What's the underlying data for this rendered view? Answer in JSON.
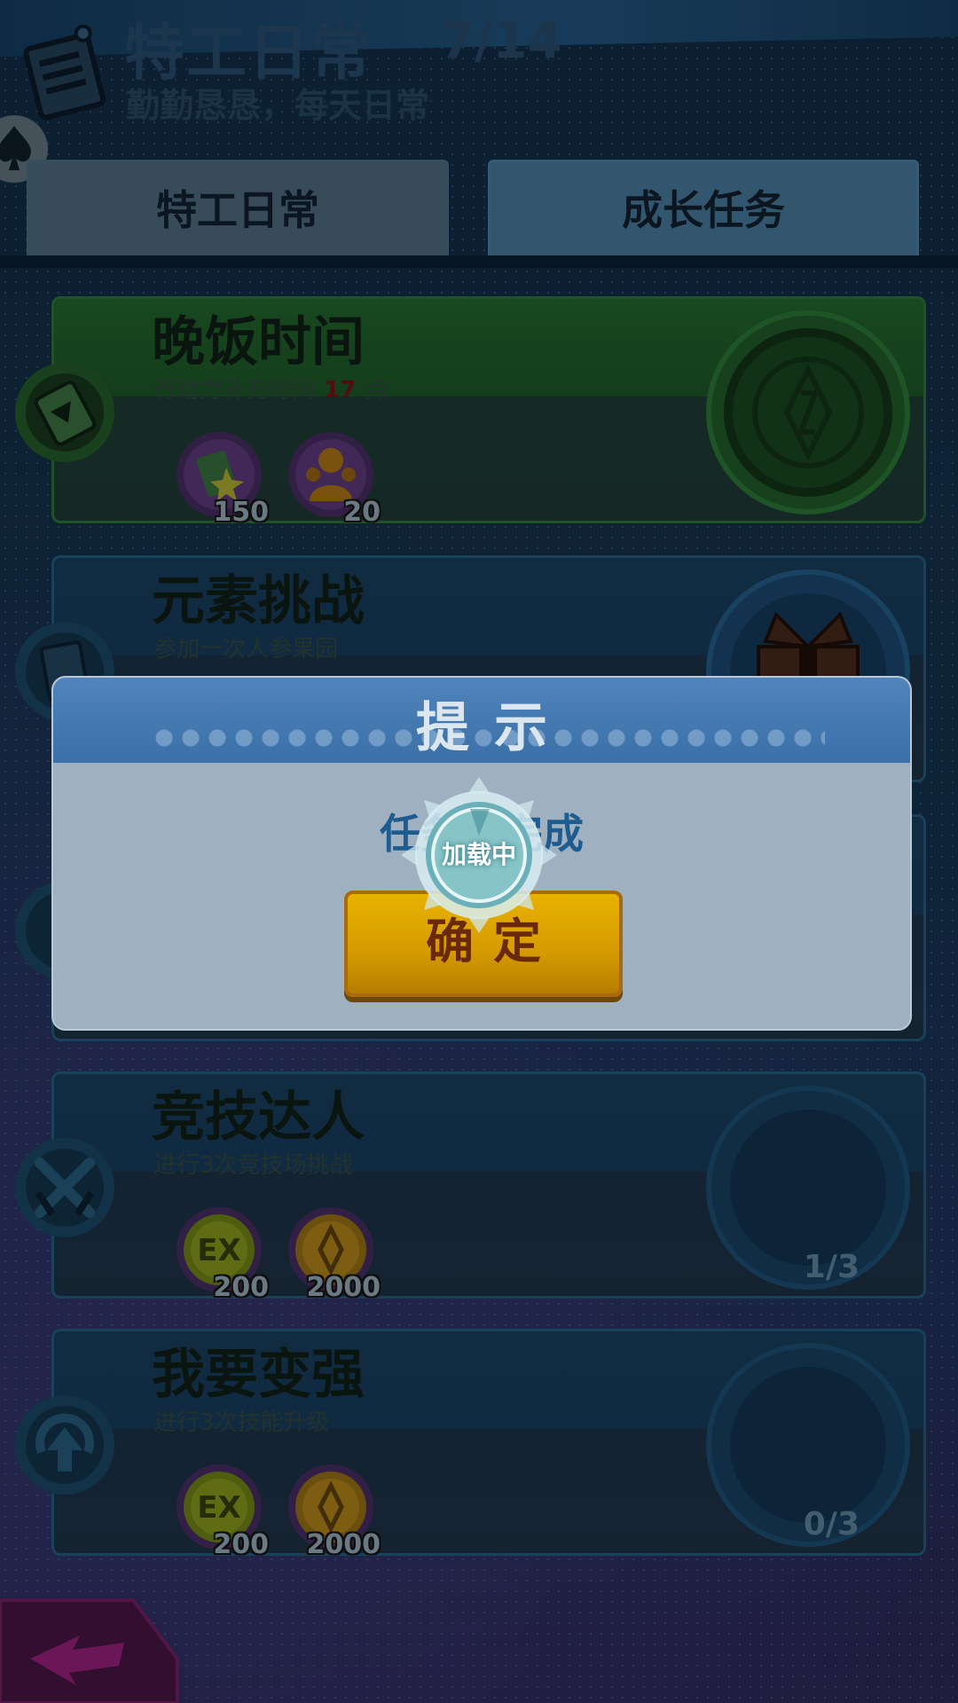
{
  "header": {
    "title": "特工日常",
    "count": "7/14",
    "subtitle": "勤勤恳恳，每天日常"
  },
  "tabs": [
    {
      "label": "特工日常",
      "active": true
    },
    {
      "label": "成长任务",
      "active": false
    }
  ],
  "tasks": [
    {
      "name": "晚饭时间",
      "desc_prefix": "行动力补充时间",
      "desc_value": "17",
      "desc_suffix": "点",
      "rewards": [
        {
          "icon": "stamina-card-icon",
          "amount": "150"
        },
        {
          "icon": "gold-figure-icon",
          "amount": "20"
        }
      ],
      "status_icon": "claim-seal-icon",
      "progress": ""
    },
    {
      "name": "元素挑战",
      "desc": "参加一次人参果园",
      "status_icon": "gift-box-icon",
      "progress": ""
    },
    {
      "name": "竞技达人",
      "desc": "进行3次竞技场挑战",
      "rewards": [
        {
          "icon": "exp-coin-icon",
          "amount": "200"
        },
        {
          "icon": "gold-coin-icon",
          "amount": "2000"
        }
      ],
      "progress": "1/3"
    },
    {
      "name": "我要变强",
      "desc": "进行3次技能升级",
      "rewards": [
        {
          "icon": "exp-coin-icon",
          "amount": "200"
        },
        {
          "icon": "gold-coin-icon",
          "amount": "2000"
        }
      ],
      "progress": "0/3"
    }
  ],
  "modal": {
    "title": "提示",
    "message": "任务已完成",
    "confirm_label": "确定"
  },
  "loading": {
    "text": "加载中"
  },
  "colors": {
    "modal_header": "#3a70a8",
    "confirm_button": "#d49a00",
    "highlight_number": "#5b1212"
  }
}
